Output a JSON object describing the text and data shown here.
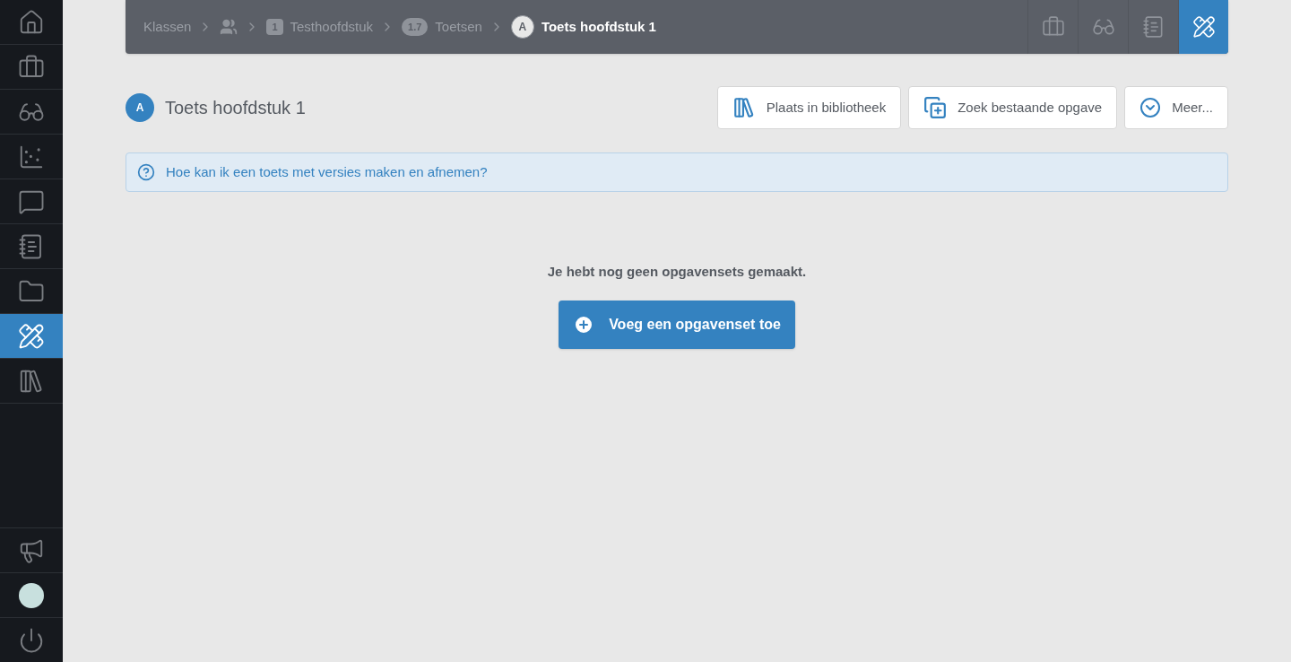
{
  "sidebar": {
    "items": [
      {
        "selected": false
      },
      {
        "selected": false
      },
      {
        "selected": false
      },
      {
        "selected": false
      },
      {
        "selected": false
      },
      {
        "selected": false
      },
      {
        "selected": false
      },
      {
        "selected": true
      },
      {
        "selected": false
      }
    ],
    "bottom_items": [
      {
        "selected": false
      },
      {
        "selected": false
      },
      {
        "selected": false
      }
    ]
  },
  "breadcrumb": [
    {
      "kind": "link",
      "label": "Klassen",
      "current": false
    },
    {
      "kind": "icon",
      "current": false
    },
    {
      "kind": "square",
      "badge": "1",
      "label": "Testhoofdstuk",
      "current": false
    },
    {
      "kind": "pill",
      "badge": "1.7",
      "label": "Toetsen",
      "current": false
    },
    {
      "kind": "circle",
      "badge": "A",
      "label": "Toets hoofdstuk 1",
      "current": true
    }
  ],
  "header_tools": [
    {
      "selected": false
    },
    {
      "selected": false
    },
    {
      "selected": false
    },
    {
      "selected": true
    }
  ],
  "page": {
    "badge": "A",
    "title": "Toets hoofdstuk 1"
  },
  "actions": [
    "Plaats in bibliotheek",
    "Zoek bestaande opgave",
    "Meer..."
  ],
  "help": {
    "text": "Hoe kan ik een toets met versies maken en afnemen?"
  },
  "empty": {
    "message": "Je hebt nog geen opgavensets gemaakt.",
    "button": "Voeg een opgavenset toe"
  }
}
